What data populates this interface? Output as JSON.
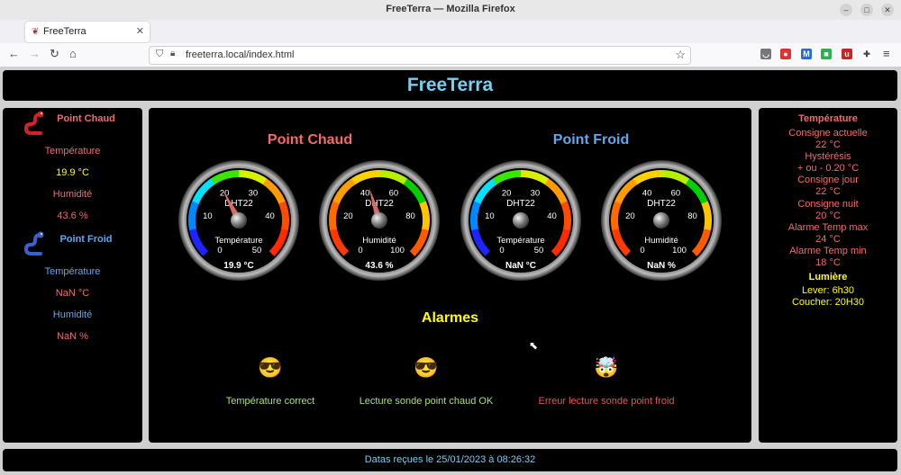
{
  "window": {
    "title": "FreeTerra — Mozilla Firefox"
  },
  "tab": {
    "label": "FreeTerra",
    "close": "✕"
  },
  "urlbar": {
    "url": "freeterra.local/index.html"
  },
  "app": {
    "title": "FreeTerra"
  },
  "left": {
    "hot_title": "Point Chaud",
    "hot_temp_label": "Température",
    "hot_temp_value": "19.9 °C",
    "hot_hum_label": "Humidité",
    "hot_hum_value": "43.6 %",
    "cold_title": "Point Froid",
    "cold_temp_label": "Température",
    "cold_temp_value": "NaN °C",
    "cold_hum_label": "Humidité",
    "cold_hum_value": "NaN %"
  },
  "gauges": {
    "hot_title": "Point Chaud",
    "cold_title": "Point Froid",
    "items": [
      {
        "sensor": "DHT22",
        "label": "Température",
        "kind": "temp",
        "value": 19.9,
        "readout": "19.9 °C"
      },
      {
        "sensor": "DHT22",
        "label": "Humidité",
        "kind": "hum",
        "value": 43.6,
        "readout": "43.6 %"
      },
      {
        "sensor": "DHT22",
        "label": "Température",
        "kind": "temp",
        "value": null,
        "readout": "NaN °C"
      },
      {
        "sensor": "DHT22",
        "label": "Humidité",
        "kind": "hum",
        "value": null,
        "readout": "NaN %"
      }
    ],
    "temp_ticks": [
      "0",
      "10",
      "20",
      "30",
      "40",
      "50"
    ],
    "hum_ticks": [
      "0",
      "20",
      "40",
      "60",
      "80",
      "100"
    ],
    "temp_range": [
      0,
      50
    ],
    "hum_range": [
      0,
      100
    ]
  },
  "alarms": {
    "title": "Alarmes",
    "items": [
      {
        "emoji": "😎",
        "text": "Température correct",
        "color": "#a6e36b"
      },
      {
        "emoji": "😎",
        "text": "Lecture sonde point chaud OK",
        "color": "#a6e36b"
      },
      {
        "emoji": "🤯",
        "text": "Erreur lecture sonde point froid",
        "color": "#f0504a"
      }
    ]
  },
  "right": {
    "temp_title": "Température",
    "consigne_actuelle_label": "Consigne actuelle",
    "consigne_actuelle_value": "22 °C",
    "hysteresis_label": "Hystérésis",
    "hysteresis_value": "+ ou - 0.20 °C",
    "consigne_jour_label": "Consigne jour",
    "consigne_jour_value": "22 °C",
    "consigne_nuit_label": "Consigne nuit",
    "consigne_nuit_value": "20 °C",
    "alarm_max_label": "Alarme Temp max",
    "alarm_max_value": "24 °C",
    "alarm_min_label": "Alarme Temp min",
    "alarm_min_value": "18 °C",
    "light_title": "Lumière",
    "lever": "Lever: 6h30",
    "coucher": "Coucher: 20H30"
  },
  "footer": {
    "text": "Datas reçues le 25/01/2023 à 08:26:32"
  },
  "colors": {
    "hot": "#f26b6b",
    "cold": "#5fa8f0",
    "accent": "#74cff2",
    "yellow": "#ffff00"
  }
}
